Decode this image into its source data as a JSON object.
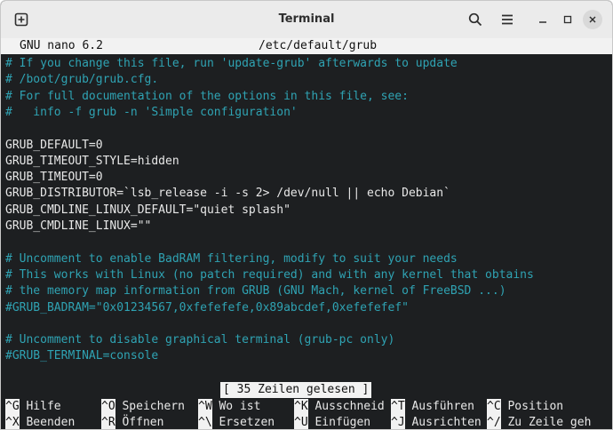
{
  "window": {
    "title": "Terminal"
  },
  "icons": {
    "new_tab": "new-tab-icon",
    "search": "search-icon",
    "menu": "hamburger-menu-icon",
    "minimize": "minimize-icon",
    "maximize": "maximize-icon",
    "close": "close-icon"
  },
  "nano": {
    "version": "GNU nano 6.2",
    "filename": "/etc/default/grub",
    "lines": [
      {
        "text": "# If you change this file, run 'update-grub' afterwards to update",
        "comment": true
      },
      {
        "text": "# /boot/grub/grub.cfg.",
        "comment": true
      },
      {
        "text": "# For full documentation of the options in this file, see:",
        "comment": true
      },
      {
        "text": "#   info -f grub -n 'Simple configuration'",
        "comment": true
      },
      {
        "text": "",
        "comment": false
      },
      {
        "text": "GRUB_DEFAULT=0",
        "comment": false
      },
      {
        "text": "GRUB_TIMEOUT_STYLE=hidden",
        "comment": false
      },
      {
        "text": "GRUB_TIMEOUT=0",
        "comment": false
      },
      {
        "text": "GRUB_DISTRIBUTOR=`lsb_release -i -s 2> /dev/null || echo Debian`",
        "comment": false
      },
      {
        "text": "GRUB_CMDLINE_LINUX_DEFAULT=\"quiet splash\"",
        "comment": false
      },
      {
        "text": "GRUB_CMDLINE_LINUX=\"\"",
        "comment": false
      },
      {
        "text": "",
        "comment": false
      },
      {
        "text": "# Uncomment to enable BadRAM filtering, modify to suit your needs",
        "comment": true
      },
      {
        "text": "# This works with Linux (no patch required) and with any kernel that obtains",
        "comment": true
      },
      {
        "text": "# the memory map information from GRUB (GNU Mach, kernel of FreeBSD ...)",
        "comment": true
      },
      {
        "text": "#GRUB_BADRAM=\"0x01234567,0xfefefefe,0x89abcdef,0xefefefef\"",
        "comment": true
      },
      {
        "text": "",
        "comment": false
      },
      {
        "text": "# Uncomment to disable graphical terminal (grub-pc only)",
        "comment": true
      },
      {
        "text": "#GRUB_TERMINAL=console",
        "comment": true
      }
    ],
    "status": "[ 35 Zeilen gelesen ]",
    "shortcuts_row1": [
      {
        "key": "^G",
        "label": "Hilfe"
      },
      {
        "key": "^O",
        "label": "Speichern"
      },
      {
        "key": "^W",
        "label": "Wo ist"
      },
      {
        "key": "^K",
        "label": "Ausschneid"
      },
      {
        "key": "^T",
        "label": "Ausführen"
      },
      {
        "key": "^C",
        "label": "Position"
      }
    ],
    "shortcuts_row2": [
      {
        "key": "^X",
        "label": "Beenden"
      },
      {
        "key": "^R",
        "label": "Öffnen"
      },
      {
        "key": "^\\",
        "label": "Ersetzen"
      },
      {
        "key": "^U",
        "label": "Einfügen"
      },
      {
        "key": "^J",
        "label": "Ausrichten"
      },
      {
        "key": "^/",
        "label": "Zu Zeile geh"
      }
    ]
  }
}
